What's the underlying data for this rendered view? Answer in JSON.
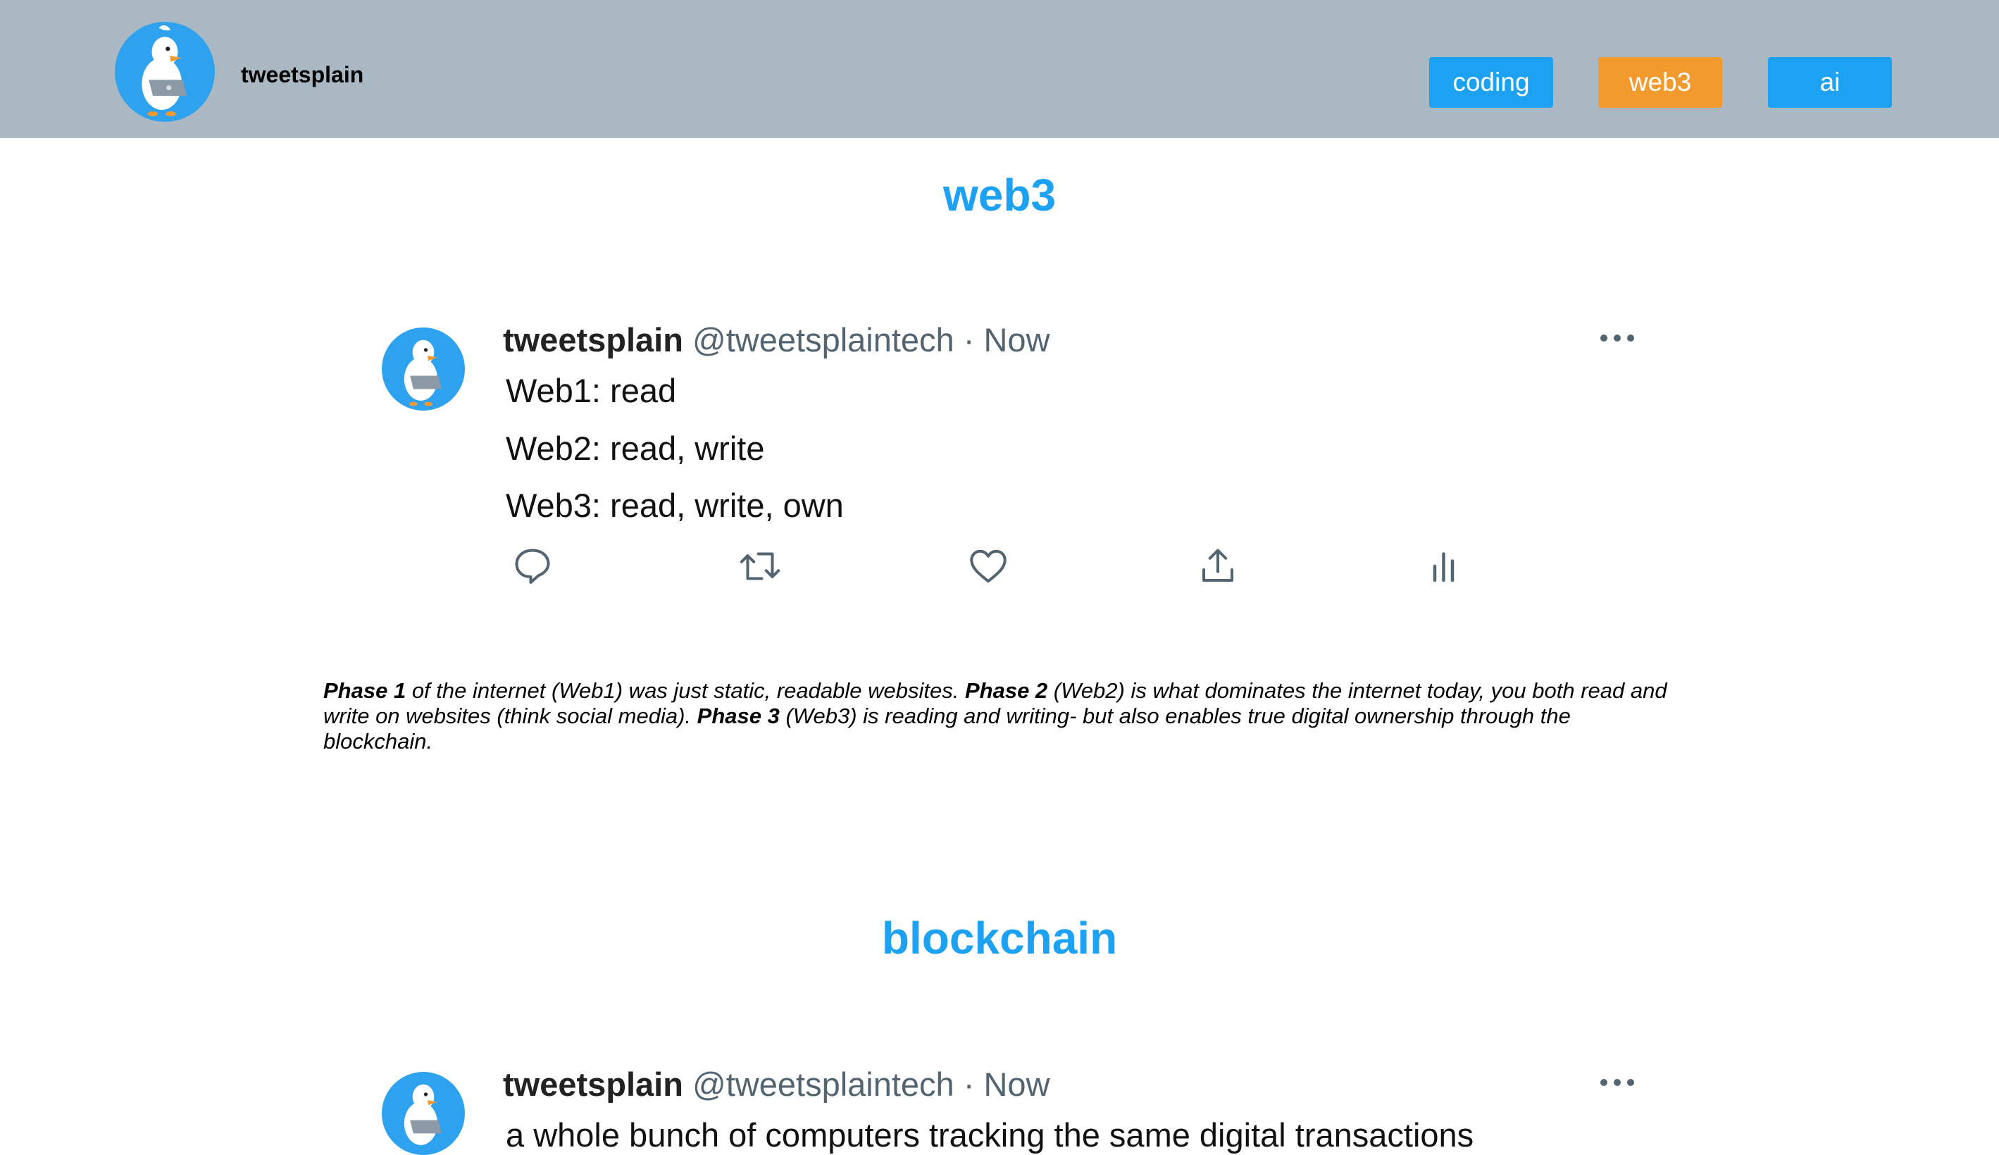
{
  "header": {
    "brand": "tweetsplain",
    "nav": [
      {
        "label": "coding",
        "color": "#1da1f2"
      },
      {
        "label": "web3",
        "color": "#f39a2f"
      },
      {
        "label": "ai",
        "color": "#1da1f2"
      }
    ]
  },
  "colors": {
    "header_bg": "#a9b8c3",
    "accent": "#1da1f2",
    "active": "#f39a2f"
  },
  "sections": [
    {
      "title": "web3",
      "tweet": {
        "name": "tweetsplain",
        "handle": "@tweetsplaintech",
        "sep": "·",
        "time": "Now",
        "lines": [
          "Web1: read",
          "Web2: read, write",
          "Web3: read, write, own"
        ],
        "actions": [
          "reply-icon",
          "retweet-icon",
          "like-icon",
          "share-icon",
          "analytics-icon"
        ]
      },
      "explanation": [
        {
          "bold": "Phase 1",
          "text": " of the internet (Web1) was just static, readable websites. "
        },
        {
          "bold": "Phase 2",
          "text": " (Web2) is what dominates the internet today, you both read and write on websites (think social media). "
        },
        {
          "bold": "Phase 3",
          "text": " (Web3) is reading and writing- but also enables true digital ownership through the blockchain."
        }
      ]
    },
    {
      "title": "blockchain",
      "tweet": {
        "name": "tweetsplain",
        "handle": "@tweetsplaintech",
        "sep": "·",
        "time": "Now",
        "lines": [
          "a whole bunch of computers tracking the same digital transactions"
        ]
      }
    }
  ]
}
